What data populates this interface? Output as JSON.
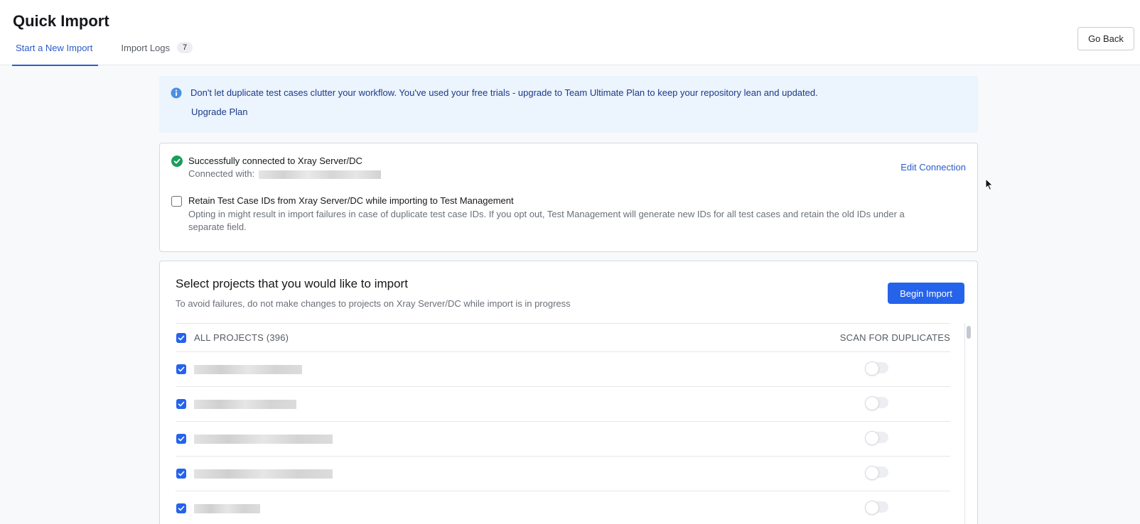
{
  "header": {
    "title": "Quick Import",
    "tabs": [
      {
        "label": "Start a New Import",
        "active": true
      },
      {
        "label": "Import Logs",
        "count": "7",
        "active": false
      }
    ],
    "go_back_label": "Go Back"
  },
  "banner": {
    "icon": "info-icon",
    "text": "Don't let duplicate test cases clutter your workflow. You've used your free trials - upgrade to Team Ultimate Plan to keep your repository lean and updated.",
    "link_label": "Upgrade Plan"
  },
  "connection": {
    "icon": "check-circle-icon",
    "title": "Successfully connected to Xray Server/DC",
    "connected_with_label": "Connected with:",
    "edit_label": "Edit Connection",
    "retain_checked": false,
    "retain_title": "Retain Test Case IDs from Xray Server/DC while importing to Test Management",
    "retain_description": "Opting in might result in import failures in case of duplicate test case IDs. If you opt out, Test Management will generate new IDs for all test cases and retain the old IDs under a separate field."
  },
  "projects": {
    "title": "Select projects that you would like to import",
    "subtitle": "To avoid failures, do not make changes to projects on Xray Server/DC while import is in progress",
    "begin_import_label": "Begin Import",
    "columns": {
      "all": "ALL PROJECTS (396)",
      "scan": "SCAN FOR DUPLICATES"
    },
    "all_checked": true,
    "rows": [
      {
        "checked": true,
        "scan": false
      },
      {
        "checked": true,
        "scan": false
      },
      {
        "checked": true,
        "scan": false
      },
      {
        "checked": true,
        "scan": false
      },
      {
        "checked": true,
        "scan": false
      }
    ]
  },
  "colors": {
    "primary": "#2563eb",
    "link": "#2b5cc9",
    "banner_bg": "#ecf4fd",
    "success": "#1a9e5c"
  }
}
